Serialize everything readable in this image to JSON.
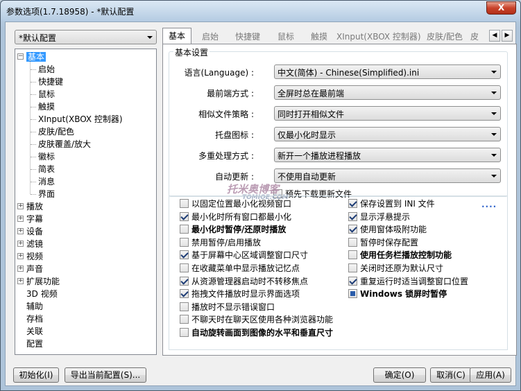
{
  "window": {
    "title": "参数选项(1.7.18958) - *默认配置",
    "close_label": "X"
  },
  "preset": {
    "value": "*默认配置"
  },
  "tree": {
    "root_label": "基本",
    "children": [
      "启始",
      "快捷键",
      "鼠标",
      "触摸",
      "XInput(XBOX 控制器)",
      "皮肤/配色",
      "皮肤覆盖/放大",
      "徽标",
      "简表",
      "消息",
      "界面"
    ],
    "top": [
      "播放",
      "字幕",
      "设备",
      "滤镜",
      "视频",
      "声音",
      "扩展功能"
    ],
    "flat": [
      "3D 视频",
      "辅助",
      "存档",
      "关联",
      "配置"
    ]
  },
  "tabs": [
    "基本",
    "启始",
    "快捷键",
    "鼠标",
    "触摸",
    "XInput(XBOX 控制器)",
    "皮肤/配色",
    "皮"
  ],
  "group": {
    "title": "基本设置",
    "rows": [
      {
        "label": "语言(Language) :",
        "value": "中文(简体) - Chinese(Simplified).ini"
      },
      {
        "label": "最前端方式 :",
        "value": "全屏时总在最前端"
      },
      {
        "label": "相似文件策略 :",
        "value": "同时打开相似文件"
      },
      {
        "label": "托盘图标 :",
        "value": "仅最小化时显示"
      },
      {
        "label": "多重处理方式 :",
        "value": "新开一个播放进程播放"
      },
      {
        "label": "自动更新 :",
        "value": "不使用自动更新"
      }
    ],
    "download_checkbox": "预先下载更新文件"
  },
  "watermark": {
    "text": "托米奥博客",
    "url": "TOMIOE.COM"
  },
  "options_left": [
    {
      "label": "以固定位置最小化视频窗口",
      "state": "unchecked",
      "bold": false
    },
    {
      "label": "最小化时所有窗口都最小化",
      "state": "checked",
      "bold": false
    },
    {
      "label": "最小化时暂停/还原时播放",
      "state": "unchecked",
      "bold": true
    },
    {
      "label": "禁用暂停/启用播放",
      "state": "unchecked",
      "bold": false
    },
    {
      "label": "基于屏幕中心区域调整窗口尺寸",
      "state": "checked",
      "bold": false
    },
    {
      "label": "在收藏菜单中显示播放记忆点",
      "state": "unchecked",
      "bold": false
    },
    {
      "label": "从资源管理器启动时不转移焦点",
      "state": "checked",
      "bold": false
    },
    {
      "label": "拖拽文件播放时显示界面选项",
      "state": "checked",
      "bold": false
    },
    {
      "label": "播放时不显示错误窗口",
      "state": "unchecked",
      "bold": false
    },
    {
      "label": "不聊天时在聊天区使用各种浏览器功能",
      "state": "unchecked",
      "bold": false
    },
    {
      "label": "自动旋转画面到图像的水平和垂直尺寸",
      "state": "unchecked",
      "bold": true
    }
  ],
  "options_right": [
    {
      "label": "保存设置到 INI 文件",
      "state": "checked",
      "bold": false
    },
    {
      "label": "显示浮悬提示",
      "state": "checked",
      "bold": false
    },
    {
      "label": "使用窗体吸附功能",
      "state": "checked",
      "bold": false
    },
    {
      "label": "暂停时保存配置",
      "state": "unchecked",
      "bold": false
    },
    {
      "label": "使用任务栏播放控制功能",
      "state": "unchecked",
      "bold": true
    },
    {
      "label": "关闭时还原为默认尺寸",
      "state": "unchecked",
      "bold": false
    },
    {
      "label": "重复运行时适当调整窗口位置",
      "state": "checked",
      "bold": false
    },
    {
      "label": "Windows 锁屏时暂停",
      "state": "indeterminate",
      "bold": true
    }
  ],
  "more_link": "....",
  "buttons": {
    "init": "初始化(I)",
    "export": "导出当前配置(S)...",
    "ok": "确定(O)",
    "cancel": "取消(C)",
    "apply": "应用(A)"
  }
}
